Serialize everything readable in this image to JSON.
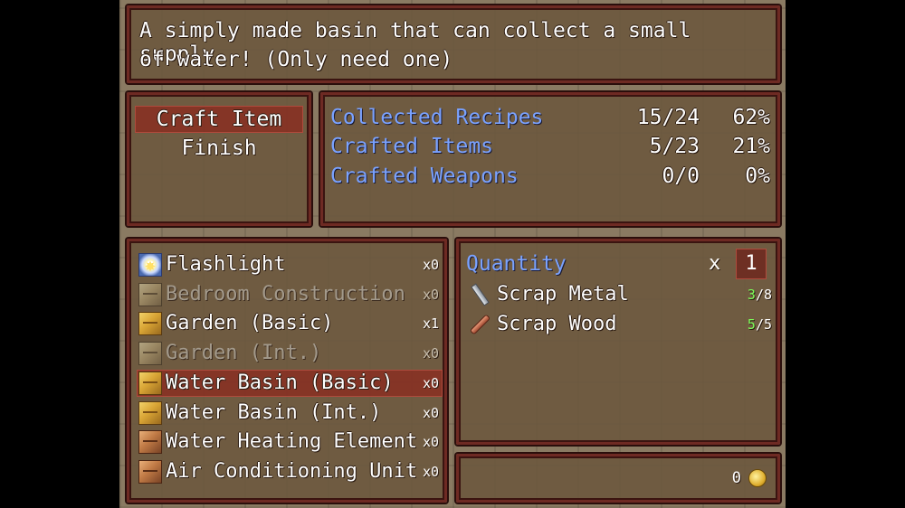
{
  "help": {
    "line1": "A simply made basin that can collect a small supply",
    "line2": "of water! (Only need one)"
  },
  "commands": [
    "Craft Item",
    "Finish"
  ],
  "stats": [
    {
      "label": "Collected Recipes",
      "count": "15/24",
      "percent": "62%"
    },
    {
      "label": "Crafted Items",
      "count": "5/23",
      "percent": "21%"
    },
    {
      "label": "Crafted Weapons",
      "count": "0/0",
      "percent": "0%"
    }
  ],
  "recipes": [
    {
      "name": "Flashlight",
      "qty": "x0",
      "icon": "flashlight-icon",
      "enabled": true
    },
    {
      "name": "Bedroom Construction",
      "qty": "x0",
      "icon": "crate-icon",
      "enabled": false
    },
    {
      "name": "Garden (Basic)",
      "qty": "x1",
      "icon": "crate-icon",
      "enabled": true
    },
    {
      "name": "Garden (Int.)",
      "qty": "x0",
      "icon": "crate-icon",
      "enabled": false
    },
    {
      "name": "Water Basin (Basic)",
      "qty": "x0",
      "icon": "crate-icon",
      "enabled": true,
      "selected": true
    },
    {
      "name": "Water Basin (Int.)",
      "qty": "x0",
      "icon": "crate-icon",
      "enabled": true
    },
    {
      "name": "Water Heating Element",
      "qty": "x0",
      "icon": "brown-crate-icon",
      "enabled": true
    },
    {
      "name": "Air Conditioning Unit",
      "qty": "x0",
      "icon": "brown-crate-icon",
      "enabled": true
    }
  ],
  "ingredients": {
    "quantity_label": "Quantity",
    "multiplier": "x",
    "quantity": "1",
    "items": [
      {
        "name": "Scrap Metal",
        "have": "3",
        "need": "/8",
        "icon": "scrap-metal-icon"
      },
      {
        "name": "Scrap Wood",
        "have": "5",
        "need": "/5",
        "icon": "scrap-wood-icon"
      }
    ]
  },
  "gold": {
    "value": "0",
    "icon": "gold-coin-icon"
  },
  "colors": {
    "frame": "#6e2a23",
    "panel_bg": "#6c583e",
    "system_blue": "#7aa2ff",
    "enough_green": "#7cff5a",
    "disabled": "#a39a8c"
  }
}
